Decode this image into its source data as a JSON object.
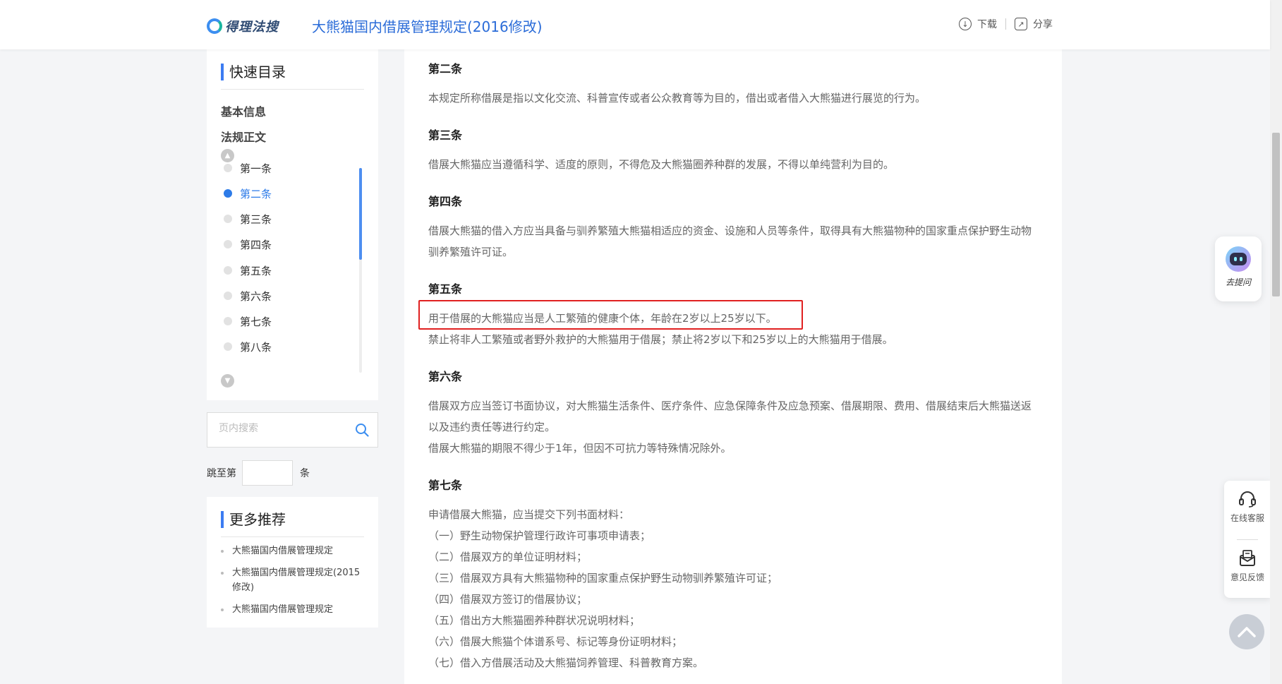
{
  "header": {
    "logo_text": "得理法搜",
    "doc_title": "大熊猫国内借展管理规定(2016修改)",
    "download_label": "下载",
    "share_label": "分享"
  },
  "toc": {
    "title": "快速目录",
    "basic_info": "基本信息",
    "body_section": "法规正文",
    "items": [
      "第一条",
      "第二条",
      "第三条",
      "第四条",
      "第五条",
      "第六条",
      "第七条",
      "第八条"
    ],
    "active_item": "第二条"
  },
  "search": {
    "placeholder": "页内搜索"
  },
  "jump": {
    "prefix": "跳至第",
    "suffix": "条",
    "value": ""
  },
  "more": {
    "title": "更多推荐",
    "items": [
      "大熊猫国内借展管理规定",
      "大熊猫国内借展管理规定(2015修改)",
      "大熊猫国内借展管理规定"
    ]
  },
  "article": {
    "s2_head": "第二条",
    "s2_p1": "本规定所称借展是指以文化交流、科普宣传或者公众教育等为目的，借出或者借入大熊猫进行展览的行为。",
    "s3_head": "第三条",
    "s3_p1": "借展大熊猫应当遵循科学、适度的原则，不得危及大熊猫圈养种群的发展，不得以单纯营利为目的。",
    "s4_head": "第四条",
    "s4_p1": "借展大熊猫的借入方应当具备与驯养繁殖大熊猫相适应的资金、设施和人员等条件，取得具有大熊猫物种的国家重点保护野生动物驯养繁殖许可证。",
    "s5_head": "第五条",
    "s5_p1": "用于借展的大熊猫应当是人工繁殖的健康个体，年龄在2岁以上25岁以下。",
    "s5_p2": "禁止将非人工繁殖或者野外救护的大熊猫用于借展；禁止将2岁以下和25岁以上的大熊猫用于借展。",
    "s6_head": "第六条",
    "s6_p1": "借展双方应当签订书面协议，对大熊猫生活条件、医疗条件、应急保障条件及应急预案、借展期限、费用、借展结束后大熊猫送返以及违约责任等进行约定。",
    "s6_p2": "借展大熊猫的期限不得少于1年，但因不可抗力等特殊情况除外。",
    "s7_head": "第七条",
    "s7_p1": "申请借展大熊猫，应当提交下列书面材料：",
    "s7_p2": "（一）野生动物保护管理行政许可事项申请表；",
    "s7_p3": "（二）借展双方的单位证明材料；",
    "s7_p4": "（三）借展双方具有大熊猫物种的国家重点保护野生动物驯养繁殖许可证；",
    "s7_p5": "（四）借展双方签订的借展协议；",
    "s7_p6": "（五）借出方大熊猫圈养种群状况说明材料；",
    "s7_p7": "（六）借展大熊猫个体谱系号、标记等身份证明材料；",
    "s7_p8": "（七）借入方借展活动及大熊猫饲养管理、科普教育方案。"
  },
  "widgets": {
    "ai_label": "去提问",
    "online_service": "在线客服",
    "feedback": "意见反馈"
  },
  "colors": {
    "accent": "#2d7be8",
    "highlight": "#e02020"
  }
}
